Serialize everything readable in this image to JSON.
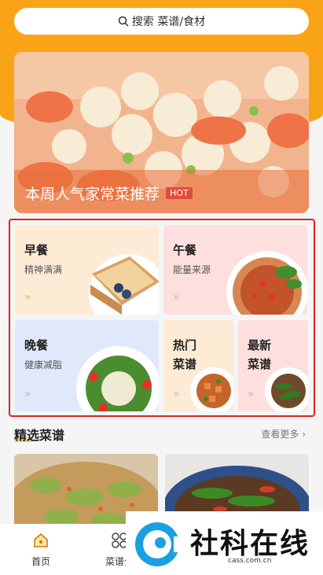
{
  "search": {
    "placeholder": "搜索 菜谱/食材",
    "icon": "search-icon"
  },
  "banner": {
    "title": "本周人气家常菜推荐",
    "badge": "HOT"
  },
  "cards": [
    {
      "title": "早餐",
      "subtitle": "精神满满"
    },
    {
      "title": "午餐",
      "subtitle": "能量来源"
    },
    {
      "title": "晚餐",
      "subtitle": "健康减脂"
    },
    {
      "title": "热门\n菜谱"
    },
    {
      "title": "最新\n菜谱"
    }
  ],
  "section": {
    "title": "精选菜谱",
    "more": "查看更多"
  },
  "tabs": [
    {
      "label": "首页",
      "icon": "home-icon"
    },
    {
      "label": "菜谱分",
      "icon": "category-icon"
    }
  ],
  "watermark": {
    "text": "社科在线",
    "url": "cass.com.cn"
  },
  "colors": {
    "accent": "#f9a417",
    "highlight": "#e1221f"
  }
}
